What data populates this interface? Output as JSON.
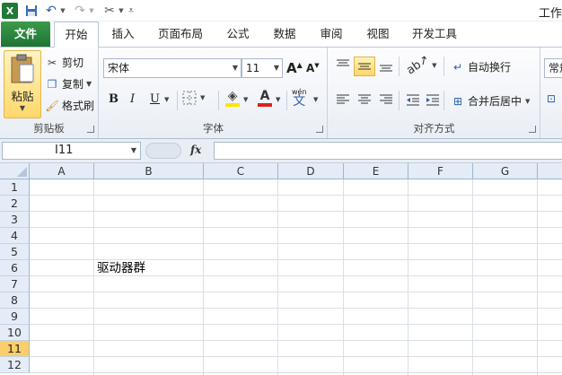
{
  "title": "工作",
  "quick_access": {
    "app_icon": "excel-icon",
    "save_icon": "save-icon",
    "undo_icon": "undo-icon",
    "redo_icon": "redo-icon",
    "customize_icon": "tools-icon"
  },
  "tabs": [
    "文件",
    "开始",
    "插入",
    "页面布局",
    "公式",
    "数据",
    "审阅",
    "视图",
    "开发工具"
  ],
  "clipboard": {
    "paste": "粘贴",
    "cut": "剪切",
    "copy": "复制",
    "format_painter": "格式刷",
    "label": "剪贴板"
  },
  "font": {
    "name": "宋体",
    "size": "11",
    "bold": "B",
    "italic": "I",
    "underline": "U",
    "font_color_letter": "A",
    "label": "字体",
    "wen": "wén",
    "wen_char": "文"
  },
  "alignment": {
    "wrap_text": "自动换行",
    "merge_center": "合并后居中",
    "label": "对齐方式"
  },
  "number": {
    "format": "常规"
  },
  "colors": {
    "file_tab": "#2a8a3e",
    "active_row": "#f8cf6a",
    "highlight": "#ffe600",
    "font_color": "#e0201a"
  },
  "formula_bar": {
    "name_box": "I11",
    "fx": "fx",
    "value": ""
  },
  "sheet": {
    "columns": [
      "A",
      "B",
      "C",
      "D",
      "E",
      "F",
      "G"
    ],
    "rows": [
      "1",
      "2",
      "3",
      "4",
      "5",
      "6",
      "7",
      "8",
      "9",
      "10",
      "11",
      "12"
    ],
    "active_row": "11",
    "cell_B6": "驱动器群"
  }
}
